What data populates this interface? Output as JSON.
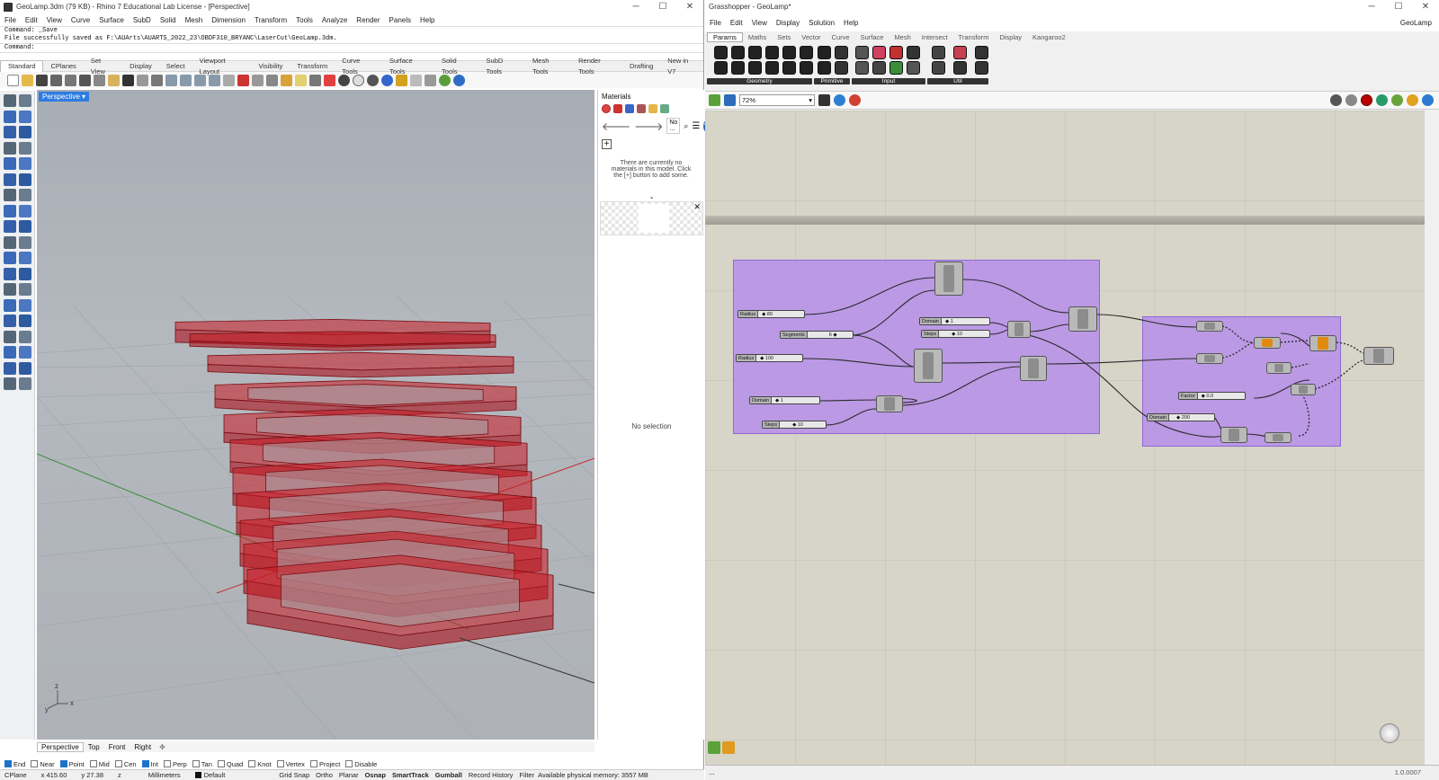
{
  "rhino": {
    "title": "GeoLamp.3dm (79 KB) - Rhino 7 Educational Lab License - [Perspective]",
    "menu": [
      "File",
      "Edit",
      "View",
      "Curve",
      "Surface",
      "SubD",
      "Solid",
      "Mesh",
      "Dimension",
      "Transform",
      "Tools",
      "Analyze",
      "Render",
      "Panels",
      "Help"
    ],
    "command_history": [
      "Command: _Save",
      "File successfully saved as F:\\AUArts\\AUARTS_2022_23\\OBDF310_BRYANC\\LaserCut\\GeoLamp.3dm."
    ],
    "command_prompt": "Command:",
    "toolbar_tabs": [
      "Standard",
      "CPlanes",
      "Set View",
      "Display",
      "Select",
      "Viewport Layout",
      "Visibility",
      "Transform",
      "Curve Tools",
      "Surface Tools",
      "Solid Tools",
      "SubD Tools",
      "Mesh Tools",
      "Render Tools",
      "Drafting",
      "New in V7"
    ],
    "viewport_label": "Perspective",
    "view_tabs": [
      "Perspective",
      "Top",
      "Front",
      "Right"
    ],
    "axis_labels": {
      "z": "z",
      "x": "x",
      "y": "y"
    },
    "materials": {
      "title": "Materials",
      "search_text": "No ...",
      "empty_msg": "There are currently no materials in this model. Click the [+] button to add some.",
      "add_symbol": "+",
      "no_selection": "No selection"
    },
    "osnaps": [
      {
        "label": "End",
        "checked": true
      },
      {
        "label": "Near",
        "checked": false
      },
      {
        "label": "Point",
        "checked": true
      },
      {
        "label": "Mid",
        "checked": false
      },
      {
        "label": "Cen",
        "checked": false
      },
      {
        "label": "Int",
        "checked": true
      },
      {
        "label": "Perp",
        "checked": false
      },
      {
        "label": "Tan",
        "checked": false
      },
      {
        "label": "Quad",
        "checked": false
      },
      {
        "label": "Knot",
        "checked": false
      },
      {
        "label": "Vertex",
        "checked": false
      },
      {
        "label": "Project",
        "checked": false
      },
      {
        "label": "Disable",
        "checked": false
      }
    ],
    "status": {
      "cplane": "CPlane",
      "x": "x 415.60",
      "y": "y 27.38",
      "z": "z",
      "units": "Millimeters",
      "layer": "Default",
      "toggles": [
        "Grid Snap",
        "Ortho",
        "Planar",
        "Osnap",
        "SmartTrack",
        "Gumball",
        "Record History",
        "Filter"
      ],
      "memory": "Available physical memory: 3557 MB"
    }
  },
  "gh": {
    "title": "Grasshopper - GeoLamp*",
    "menu": [
      "File",
      "Edit",
      "View",
      "Display",
      "Solution",
      "Help"
    ],
    "doc_name": "GeoLamp",
    "tabs": [
      "Params",
      "Maths",
      "Sets",
      "Vector",
      "Curve",
      "Surface",
      "Mesh",
      "Intersect",
      "Transform",
      "Display",
      "Kangaroo2"
    ],
    "categories": [
      "Geometry",
      "Primitive",
      "Input",
      "Util"
    ],
    "zoom": "72%",
    "version": "1.0.0007",
    "sliders": [
      {
        "id": "radius1",
        "label": "Radius",
        "value": "◆ 80"
      },
      {
        "id": "segments",
        "label": "Segments",
        "value": "6 ◆"
      },
      {
        "id": "radius2",
        "label": "Radius",
        "value": "◆ 100"
      },
      {
        "id": "domain1",
        "label": "Domain",
        "value": "◆ 1"
      },
      {
        "id": "steps1",
        "label": "Steps",
        "value": "◆ 10"
      },
      {
        "id": "domain2",
        "label": "Domain",
        "value": "◆ 1"
      },
      {
        "id": "steps2",
        "label": "Steps",
        "value": "◆ 10"
      },
      {
        "id": "factor",
        "label": "Factor",
        "value": "◆ 0.0"
      },
      {
        "id": "domain3",
        "label": "Domain",
        "value": "◆ 200"
      }
    ]
  },
  "colors": {
    "accent": "#2e7ce0",
    "group": "#b48ceb",
    "lamp": "#c0202a"
  }
}
